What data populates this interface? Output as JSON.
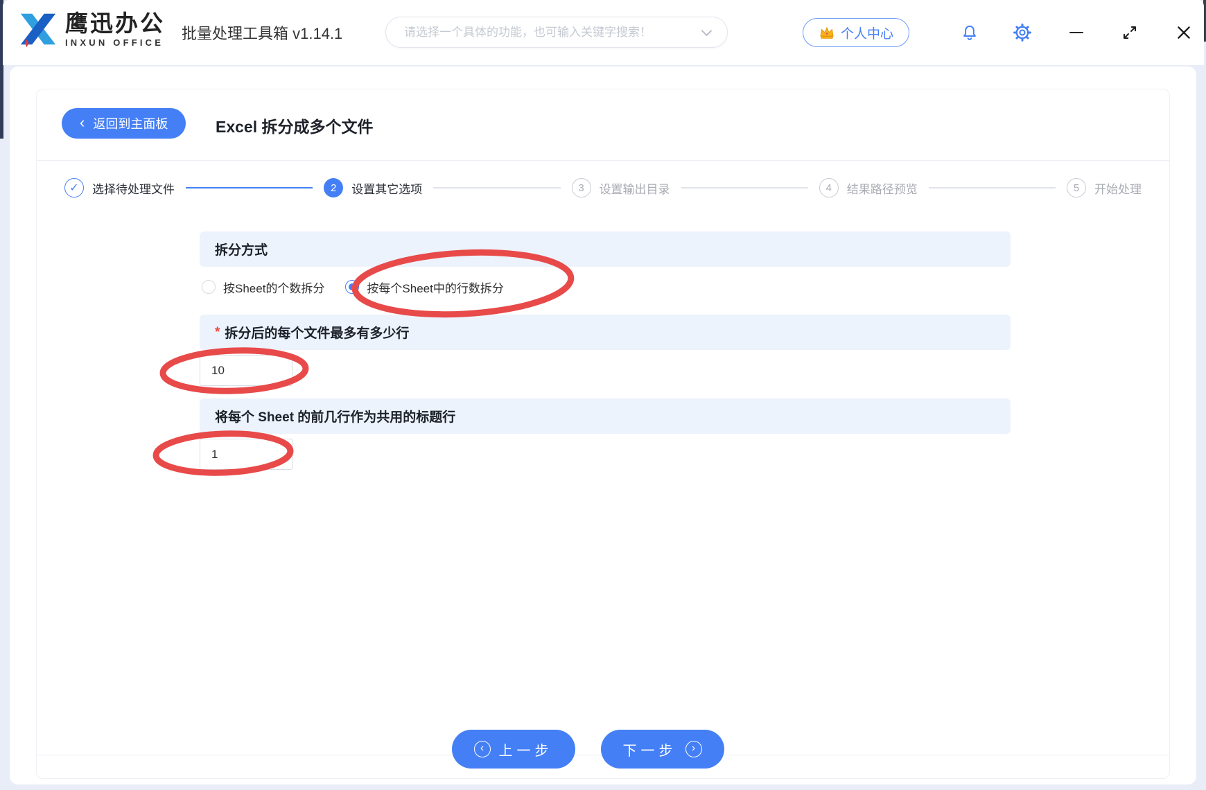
{
  "colors": {
    "primary": "#447ff5",
    "annotation": "#e84a4a",
    "band_bg": "#edf3fd"
  },
  "icons": {
    "check": "✓",
    "back_chevron": "‹",
    "prev_chevron": "‹",
    "next_chevron": "›"
  },
  "titlebar": {
    "brand": {
      "name": "鹰迅办公",
      "subtitle": "INXUN OFFICE"
    },
    "app_title": "批量处理工具箱 v1.14.1",
    "search_placeholder": "请选择一个具体的功能，也可输入关键字搜索！",
    "user_center_label": "个人中心"
  },
  "page": {
    "back_button": "返回到主面板",
    "title": "Excel 拆分成多个文件"
  },
  "steps": [
    {
      "num": "1",
      "label": "选择待处理文件",
      "state": "done"
    },
    {
      "num": "2",
      "label": "设置其它选项",
      "state": "active"
    },
    {
      "num": "3",
      "label": "设置输出目录",
      "state": "pending"
    },
    {
      "num": "4",
      "label": "结果路径预览",
      "state": "pending"
    },
    {
      "num": "5",
      "label": "开始处理",
      "state": "pending"
    }
  ],
  "form": {
    "split_mode": {
      "label": "拆分方式",
      "options": [
        {
          "label": "按Sheet的个数拆分",
          "selected": false
        },
        {
          "label": "按每个Sheet中的行数拆分",
          "selected": true
        }
      ]
    },
    "max_rows": {
      "required_mark": "*",
      "label": "拆分后的每个文件最多有多少行",
      "value": "10"
    },
    "header_rows": {
      "label": "将每个 Sheet 的前几行作为共用的标题行",
      "value": "1"
    }
  },
  "footer": {
    "prev_label": "上一步",
    "next_label": "下一步"
  }
}
